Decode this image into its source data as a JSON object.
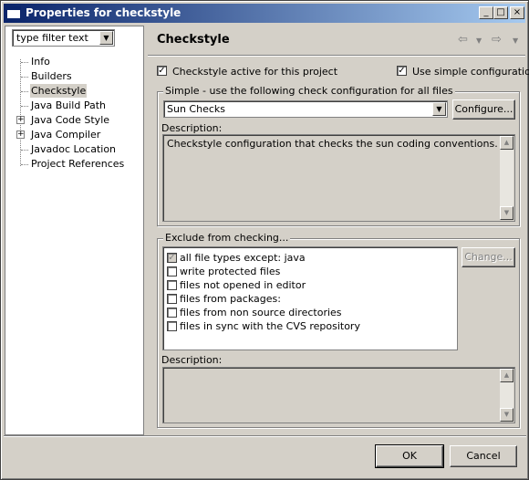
{
  "window": {
    "title": "Properties for checkstyle",
    "minimize": "_",
    "maximize": "□",
    "close": "×"
  },
  "sidebar": {
    "filter_value": "type filter text",
    "items": [
      {
        "label": "Info"
      },
      {
        "label": "Builders"
      },
      {
        "label": "Checkstyle"
      },
      {
        "label": "Java Build Path"
      },
      {
        "label": "Java Code Style"
      },
      {
        "label": "Java Compiler"
      },
      {
        "label": "Javadoc Location"
      },
      {
        "label": "Project References"
      }
    ],
    "selected": "Checkstyle"
  },
  "page": {
    "title": "Checkstyle",
    "nav": {
      "back": "⇦",
      "forward": "⇨",
      "dropdown": "▼"
    },
    "active_label": "Checkstyle active for this project",
    "simple_label": "Use simple configuration",
    "simple_group": {
      "legend": "Simple - use the following check configuration for all files",
      "config_value": "Sun Checks",
      "configure_button": "Configure...",
      "description_label": "Description:",
      "description_text": "Checkstyle configuration that checks the sun coding conventions."
    },
    "exclude_group": {
      "legend": "Exclude from checking...",
      "change_button": "Change...",
      "filters": [
        {
          "label": "all file types except: java",
          "checked": true
        },
        {
          "label": "write protected files",
          "checked": false
        },
        {
          "label": "files not opened in editor",
          "checked": false
        },
        {
          "label": "files from packages:",
          "checked": false
        },
        {
          "label": "files from non source directories",
          "checked": false
        },
        {
          "label": "files in sync with the CVS repository",
          "checked": false
        }
      ],
      "description_label": "Description:",
      "description_text": ""
    }
  },
  "footer": {
    "ok": "OK",
    "cancel": "Cancel"
  },
  "icons": {
    "check": "✓",
    "plus": "+",
    "dropdown": "▼",
    "scroll_up": "▲",
    "scroll_down": "▼"
  }
}
